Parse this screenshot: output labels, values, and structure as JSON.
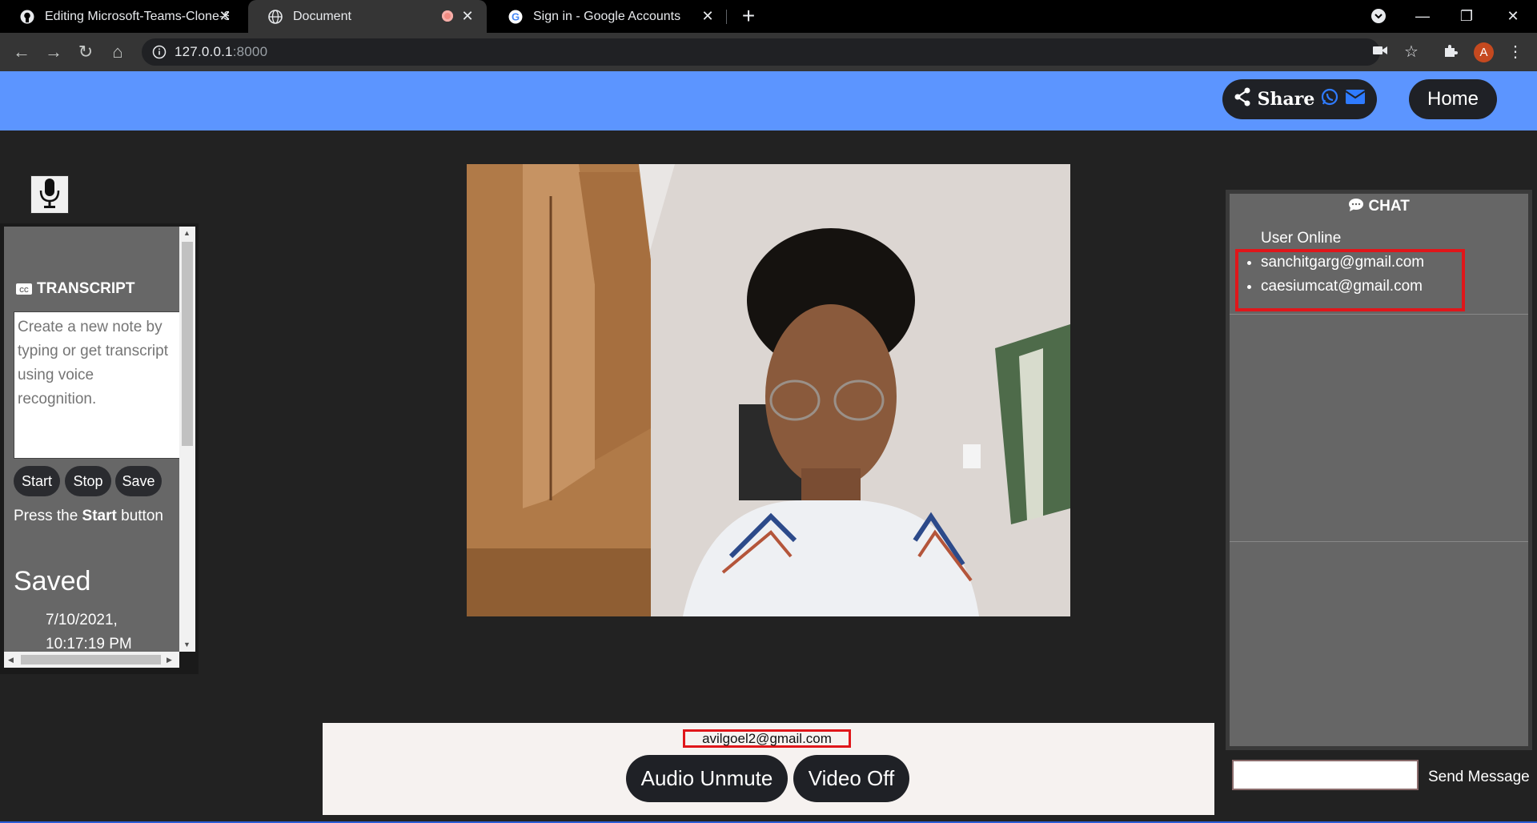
{
  "browser": {
    "tabs": [
      {
        "title": "Editing Microsoft-Teams-Clone-S",
        "icon": "github-icon",
        "active": false
      },
      {
        "title": "Document",
        "icon": "globe-icon",
        "active": true,
        "recording": true
      },
      {
        "title": "Sign in - Google Accounts",
        "icon": "google-icon",
        "active": false
      }
    ],
    "url_host": "127.0.0.1",
    "url_port": ":8000",
    "profile_initial": "A"
  },
  "header": {
    "share_label": "Share",
    "home_label": "Home"
  },
  "transcript": {
    "title": "TRANSCRIPT",
    "placeholder": "Create a new note by typing or get transcript using voice recognition.",
    "buttons": {
      "start": "Start",
      "stop": "Stop",
      "save": "Save"
    },
    "instruction_prefix": "Press the ",
    "instruction_bold": "Start",
    "instruction_suffix": " button",
    "saved_heading": "Saved",
    "saved_notes": [
      "7/10/2021, 10:17:19 PM"
    ]
  },
  "video": {
    "user_email": "avilgoel2@gmail.com",
    "audio_button": "Audio Unmute",
    "video_button": "Video Off"
  },
  "chat": {
    "title": "CHAT",
    "online_label": "User Online",
    "users": [
      "sanchitgarg@gmail.com",
      "caesiumcat@gmail.com"
    ],
    "send_label": "Send Message"
  },
  "colors": {
    "appbar": "#5c95ff",
    "button_dark": "#1f2126",
    "highlight": "#e0161a",
    "panel_gray": "#666666"
  }
}
